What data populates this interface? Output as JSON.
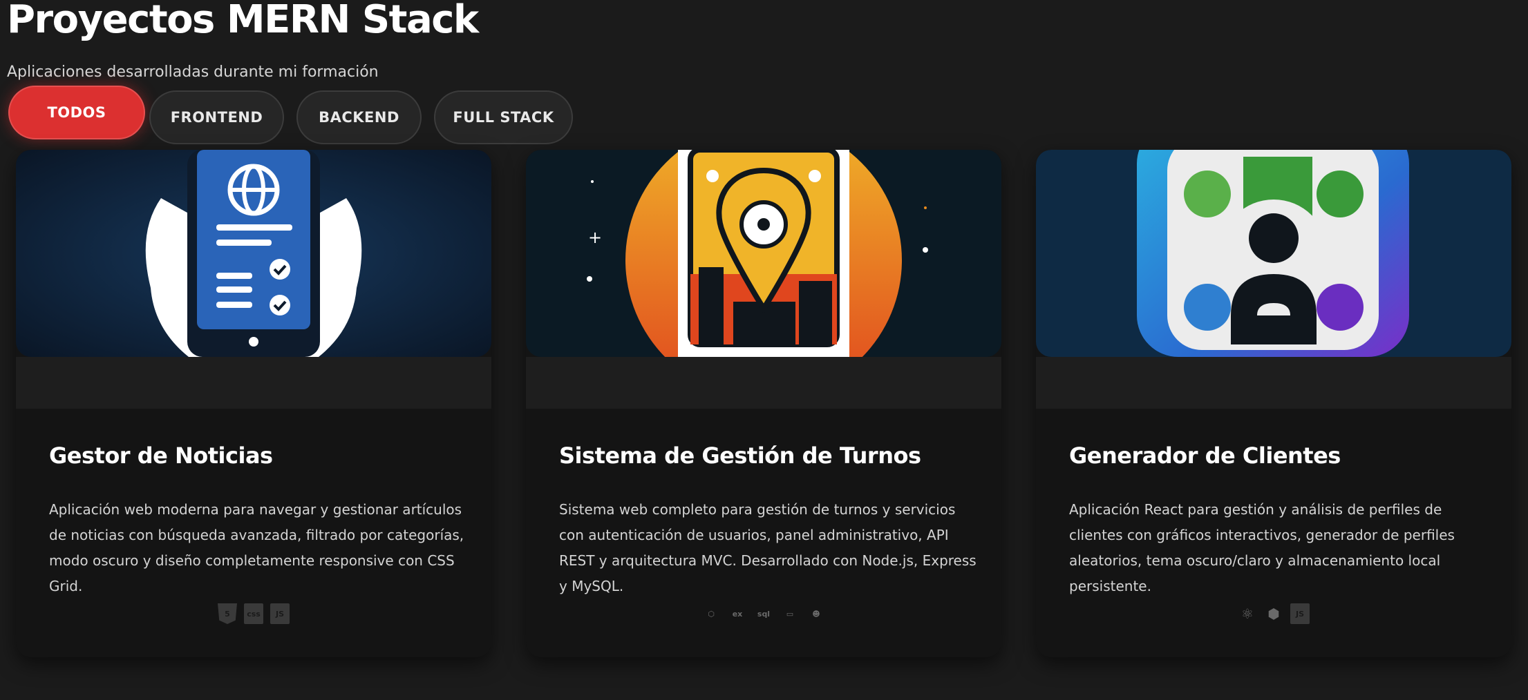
{
  "header": {
    "title": "Proyectos MERN Stack",
    "subtitle": "Aplicaciones desarrolladas durante mi formación"
  },
  "filters": {
    "items": [
      {
        "label": "TODOS",
        "active": true
      },
      {
        "label": "FRONTEND",
        "active": false
      },
      {
        "label": "BACKEND",
        "active": false
      },
      {
        "label": "FULL STACK",
        "active": false
      }
    ]
  },
  "colors": {
    "accent": "#dc3030",
    "background": "#1b1b1b",
    "card": "#141414"
  },
  "projects": [
    {
      "title": "Gestor de Noticias",
      "description": "Aplicación web moderna para navegar y gestionar artículos de noticias con búsqueda avanzada, filtrado por categorías, modo oscuro y diseño completamente responsive con CSS Grid.",
      "image_icon": "phone-news-icon",
      "tech_icons": [
        "html5-icon",
        "css3-icon",
        "javascript-icon"
      ],
      "tech_labels": [
        "5",
        "css",
        "JS"
      ]
    },
    {
      "title": "Sistema de Gestión de Turnos",
      "description": "Sistema web completo para gestión de turnos y servicios con autenticación de usuarios, panel administrativo, API REST y arquitectura MVC. Desarrollado con Node.js, Express y MySQL.",
      "image_icon": "map-pin-city-icon",
      "tech_icons": [
        "nodejs-icon",
        "express-icon",
        "mysql-icon",
        "docker-icon",
        "typeorm-icon"
      ],
      "tech_labels": [
        "⬡",
        "ex",
        "sql",
        "▭",
        "☻"
      ]
    },
    {
      "title": "Generador de Clientes",
      "description": "Aplicación React para gestión y análisis de perfiles de clientes con gráficos interactivos, generador de perfiles aleatorios, tema oscuro/claro y almacenamiento local persistente.",
      "image_icon": "user-profile-app-icon",
      "tech_icons": [
        "react-icon",
        "package-icon",
        "javascript-icon"
      ],
      "tech_labels": [
        "⚛",
        "⬢",
        "JS"
      ]
    }
  ]
}
